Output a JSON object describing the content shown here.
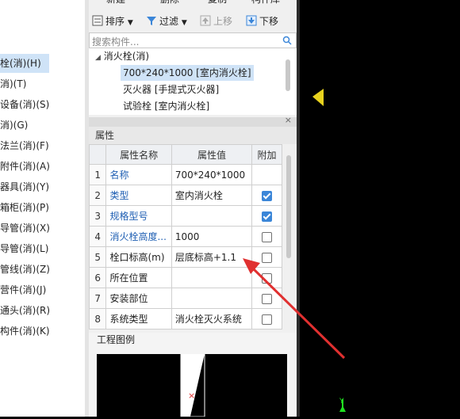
{
  "left_tree": {
    "items": [
      {
        "label": "栓(消)(H)",
        "selected": true
      },
      {
        "label": "消)(T)",
        "selected": false
      },
      {
        "label": "设备(消)(S)",
        "selected": false
      },
      {
        "label": "消)(G)",
        "selected": false
      },
      {
        "label": "法兰(消)(F)",
        "selected": false
      },
      {
        "label": "附件(消)(A)",
        "selected": false
      },
      {
        "label": "器具(消)(Y)",
        "selected": false
      },
      {
        "label": "箱柜(消)(P)",
        "selected": false
      },
      {
        "label": "导管(消)(X)",
        "selected": false
      },
      {
        "label": "导管(消)(L)",
        "selected": false
      },
      {
        "label": "管线(消)(Z)",
        "selected": false
      },
      {
        "label": "营件(消)(J)",
        "selected": false
      },
      {
        "label": "通头(消)(R)",
        "selected": false
      },
      {
        "label": "构件(消)(K)",
        "selected": false
      }
    ]
  },
  "toolbar_top": {
    "new": "新建",
    "delete": "删除",
    "copy": "复制",
    "lib": "构件库"
  },
  "toolbar": {
    "sort": "排序",
    "filter": "过滤",
    "up": "上移",
    "down": "下移"
  },
  "search": {
    "placeholder": "搜索构件..."
  },
  "component_tree": {
    "group": "消火栓(消)",
    "items": [
      {
        "label": "700*240*1000 [室内消火栓]",
        "selected": true
      },
      {
        "label": "灭火器 [手提式灭火器]",
        "selected": false
      },
      {
        "label": "试验栓 [室内消火栓]",
        "selected": false
      }
    ]
  },
  "properties": {
    "title": "属性",
    "columns": [
      "属性名称",
      "属性值",
      "附加"
    ],
    "rows": [
      {
        "num": "1",
        "name": "名称",
        "value": "700*240*1000",
        "blue": true,
        "checkbox": "none"
      },
      {
        "num": "2",
        "name": "类型",
        "value": "室内消火栓",
        "blue": true,
        "checkbox": "checked"
      },
      {
        "num": "3",
        "name": "规格型号",
        "value": "",
        "blue": true,
        "checkbox": "checked"
      },
      {
        "num": "4",
        "name": "消火栓高度...",
        "value": "1000",
        "blue": true,
        "checkbox": "unchecked"
      },
      {
        "num": "5",
        "name": "栓口标高(m)",
        "value": "层底标高+1.1",
        "blue": false,
        "checkbox": "unchecked"
      },
      {
        "num": "6",
        "name": "所在位置",
        "value": "",
        "blue": false,
        "checkbox": "unchecked"
      },
      {
        "num": "7",
        "name": "安装部位",
        "value": "",
        "blue": false,
        "checkbox": "unchecked"
      },
      {
        "num": "8",
        "name": "系统类型",
        "value": "消火栓灭火系统",
        "blue": false,
        "checkbox": "unchecked"
      }
    ]
  },
  "legend": {
    "title": "工程图例"
  },
  "canvas": {
    "axis_label": "Y"
  },
  "colors": {
    "accent": "#3b86d8",
    "link": "#1f5fb3",
    "arrow": "#e03030",
    "selection": "#cfe3f7"
  }
}
